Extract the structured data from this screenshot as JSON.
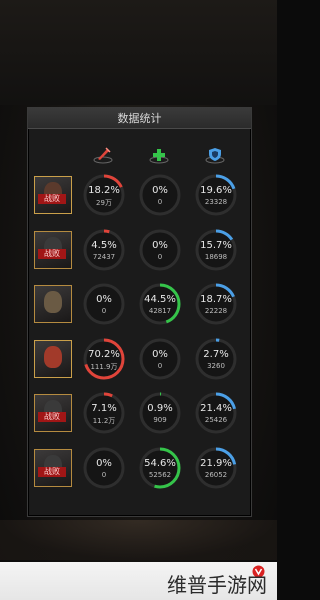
{
  "panel": {
    "title": "数据统计"
  },
  "columns": [
    {
      "name": "damage-icon",
      "color": "#e0443a"
    },
    {
      "name": "heal-icon",
      "color": "#35c44a"
    },
    {
      "name": "shield-icon",
      "color": "#4b9fe6"
    }
  ],
  "rows": [
    {
      "badge": "战败",
      "damage": {
        "pct": "18.2%",
        "val": "29万",
        "fraction": 0.182
      },
      "heal": {
        "pct": "0%",
        "val": "0",
        "fraction": 0
      },
      "shield": {
        "pct": "19.6%",
        "val": "23328",
        "fraction": 0.196
      }
    },
    {
      "badge": "战败",
      "damage": {
        "pct": "4.5%",
        "val": "72437",
        "fraction": 0.045
      },
      "heal": {
        "pct": "0%",
        "val": "0",
        "fraction": 0
      },
      "shield": {
        "pct": "15.7%",
        "val": "18698",
        "fraction": 0.157
      }
    },
    {
      "badge": "",
      "damage": {
        "pct": "0%",
        "val": "0",
        "fraction": 0
      },
      "heal": {
        "pct": "44.5%",
        "val": "42817",
        "fraction": 0.445
      },
      "shield": {
        "pct": "18.7%",
        "val": "22228",
        "fraction": 0.187
      }
    },
    {
      "badge": "",
      "damage": {
        "pct": "70.2%",
        "val": "111.9万",
        "fraction": 0.702
      },
      "heal": {
        "pct": "0%",
        "val": "0",
        "fraction": 0
      },
      "shield": {
        "pct": "2.7%",
        "val": "3260",
        "fraction": 0.027
      }
    },
    {
      "badge": "战败",
      "damage": {
        "pct": "7.1%",
        "val": "11.2万",
        "fraction": 0.071
      },
      "heal": {
        "pct": "0.9%",
        "val": "909",
        "fraction": 0.009
      },
      "shield": {
        "pct": "21.4%",
        "val": "25426",
        "fraction": 0.214
      }
    },
    {
      "badge": "战败",
      "damage": {
        "pct": "0%",
        "val": "0",
        "fraction": 0
      },
      "heal": {
        "pct": "54.6%",
        "val": "52562",
        "fraction": 0.546
      },
      "shield": {
        "pct": "21.9%",
        "val": "26052",
        "fraction": 0.219
      }
    }
  ],
  "watermark": {
    "text": "维普手游网"
  }
}
